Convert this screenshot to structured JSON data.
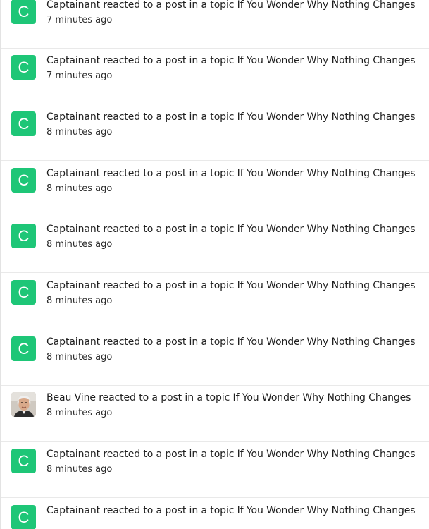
{
  "notifications": [
    {
      "avatar_letter": "C",
      "avatar_type": "letter",
      "message": "Captainant reacted to a post in a topic If You Wonder Why Nothing Changes",
      "time": "7 minutes ago"
    },
    {
      "avatar_letter": "C",
      "avatar_type": "letter",
      "message": "Captainant reacted to a post in a topic If You Wonder Why Nothing Changes",
      "time": "7 minutes ago"
    },
    {
      "avatar_letter": "C",
      "avatar_type": "letter",
      "message": "Captainant reacted to a post in a topic If You Wonder Why Nothing Changes",
      "time": "8 minutes ago"
    },
    {
      "avatar_letter": "C",
      "avatar_type": "letter",
      "message": "Captainant reacted to a post in a topic If You Wonder Why Nothing Changes",
      "time": "8 minutes ago"
    },
    {
      "avatar_letter": "C",
      "avatar_type": "letter",
      "message": "Captainant reacted to a post in a topic If You Wonder Why Nothing Changes",
      "time": "8 minutes ago"
    },
    {
      "avatar_letter": "C",
      "avatar_type": "letter",
      "message": "Captainant reacted to a post in a topic If You Wonder Why Nothing Changes",
      "time": "8 minutes ago"
    },
    {
      "avatar_letter": "C",
      "avatar_type": "letter",
      "message": "Captainant reacted to a post in a topic If You Wonder Why Nothing Changes",
      "time": "8 minutes ago"
    },
    {
      "avatar_letter": "",
      "avatar_type": "photo",
      "message": "Beau Vine reacted to a post in a topic If You Wonder Why Nothing Changes",
      "time": "8 minutes ago"
    },
    {
      "avatar_letter": "C",
      "avatar_type": "letter",
      "message": "Captainant reacted to a post in a topic If You Wonder Why Nothing Changes",
      "time": "8 minutes ago"
    },
    {
      "avatar_letter": "C",
      "avatar_type": "letter",
      "message": "Captainant reacted to a post in a topic If You Wonder Why Nothing Changes",
      "time": ""
    }
  ],
  "colors": {
    "avatar_green": "#1ec677",
    "divider": "#e9e9e9"
  }
}
